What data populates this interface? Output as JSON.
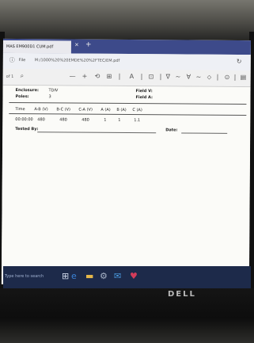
{
  "browser": {
    "tab_title": "MAS EM900D1 CUM.pdf",
    "tab_close": "×",
    "tab_new": "+",
    "addr_label": "File",
    "url": "M:/1000%20%20EMDE%20%2FTEC/EM.pdf",
    "info_icon": "ⓘ",
    "reload_icon": "↻"
  },
  "pdf_toolbar": {
    "page": "of 1",
    "search_icon": "⌕",
    "zoom_out": "—",
    "zoom_in": "+",
    "rotate_icon": "⟲",
    "fit_icon": "⊞",
    "icons": [
      "|",
      "A",
      "|",
      "⊡",
      "|",
      "∇",
      "~",
      "∀",
      "~",
      "⬦",
      "|",
      "⊙",
      "|",
      "▤"
    ]
  },
  "document": {
    "enclosure_label": "Enclosure:",
    "enclosure_value": "TDIV",
    "poles_label": "Poles:",
    "poles_value": "3",
    "field_v": "Field V:",
    "field_a": "Field A:",
    "columns": [
      "Time",
      "A-B (V)",
      "B-C (V)",
      "C-A (V)",
      "A (A)",
      "B (A)",
      "C (A)"
    ],
    "row": [
      "00:00:00",
      "480",
      "480",
      "480",
      "1",
      "1",
      "1.1"
    ],
    "tested_by": "Tested By:",
    "date": "Date:"
  },
  "taskbar": {
    "search_text": "Type here to search"
  },
  "monitor": {
    "brand": "DELL"
  }
}
